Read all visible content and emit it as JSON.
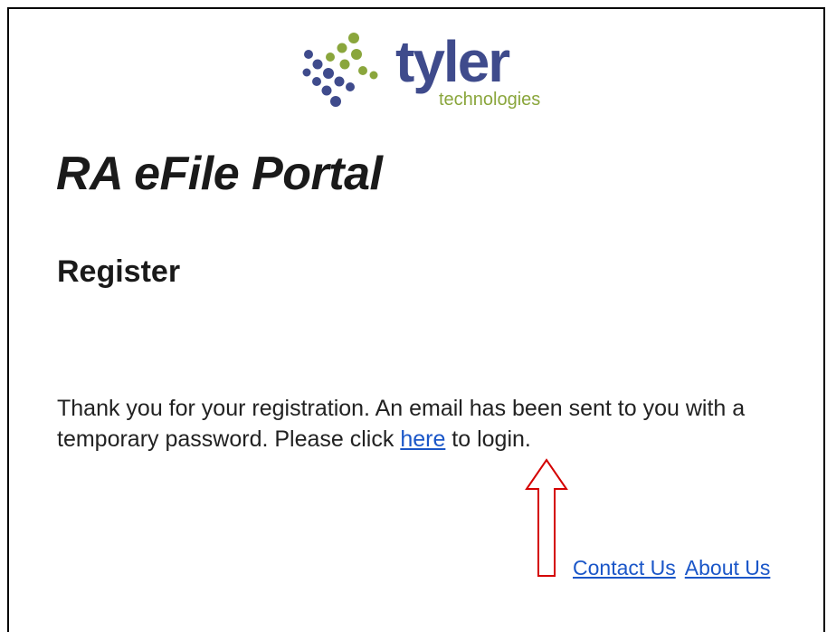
{
  "logo": {
    "word": "tyler",
    "subtitle": "technologies",
    "brand_blue": "#3f4b8c",
    "brand_green": "#8aa63c"
  },
  "page": {
    "title": "RA eFile Portal",
    "heading": "Register"
  },
  "message": {
    "text_before": "Thank you for your registration. An email has been sent to you with a temporary password. Please click ",
    "link_label": "here",
    "text_after": " to login."
  },
  "annotation": {
    "arrow_color": "#d40000",
    "arrow_icon": "up-arrow-icon"
  },
  "footer": {
    "contact_label": "Contact Us",
    "about_label": "About Us"
  }
}
